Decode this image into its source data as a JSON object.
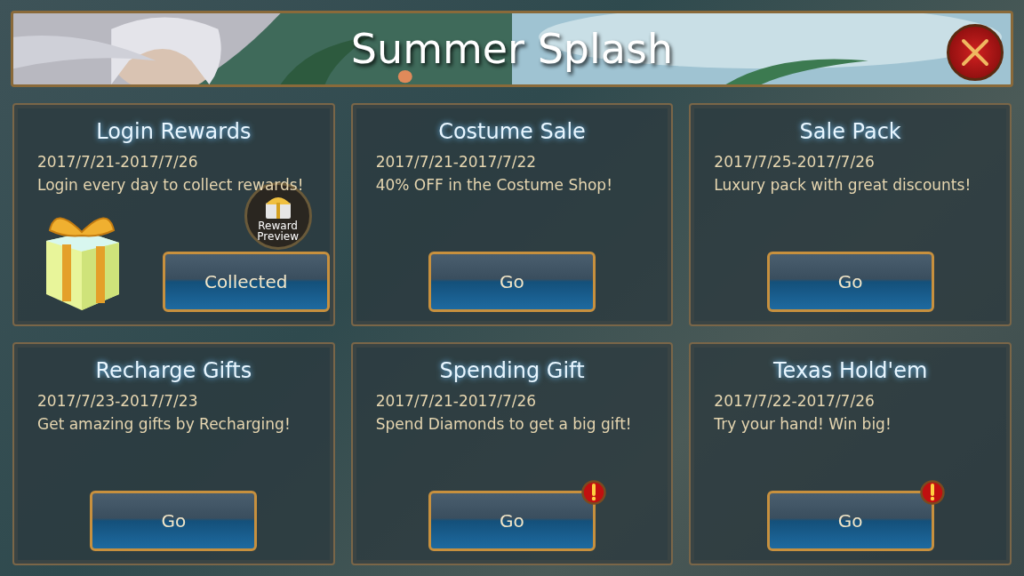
{
  "header": {
    "title": "Summer Splash"
  },
  "events": [
    {
      "kind": "login",
      "title": "Login Rewards",
      "dates": "2017/7/21-2017/7/26",
      "description": "Login every day to collect rewards!",
      "preview_label": "Reward Preview",
      "button": "Collected",
      "alert": false
    },
    {
      "kind": "event",
      "title": "Costume Sale",
      "dates": "2017/7/21-2017/7/22",
      "description": "40% OFF in the Costume Shop!",
      "button": "Go",
      "alert": false
    },
    {
      "kind": "event",
      "title": "Sale Pack",
      "dates": "2017/7/25-2017/7/26",
      "description": "Luxury pack with great discounts!",
      "button": "Go",
      "alert": false
    },
    {
      "kind": "event",
      "title": "Recharge Gifts",
      "dates": "2017/7/23-2017/7/23",
      "description": "Get amazing gifts by Recharging!",
      "button": "Go",
      "alert": false
    },
    {
      "kind": "event",
      "title": "Spending Gift",
      "dates": "2017/7/21-2017/7/26",
      "description": "Spend Diamonds to get a big gift!",
      "button": "Go",
      "alert": true
    },
    {
      "kind": "event",
      "title": "Texas Hold'em",
      "dates": "2017/7/22-2017/7/26",
      "description": "Try your hand! Win big!",
      "button": "Go",
      "alert": true
    }
  ]
}
